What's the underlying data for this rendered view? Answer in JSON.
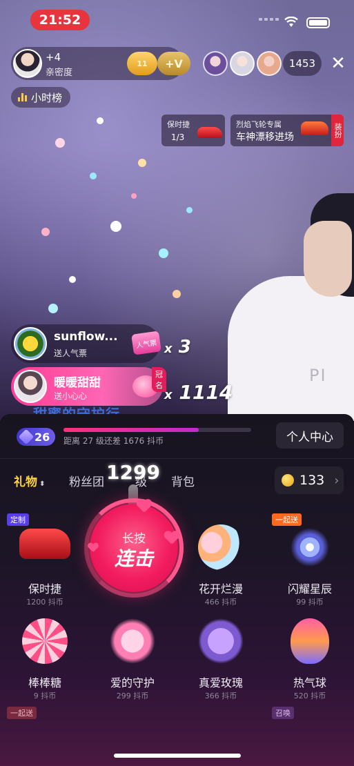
{
  "status_bar": {
    "time": "21:52"
  },
  "host": {
    "intimacy_plus": "+4",
    "intimacy_label": "亲密度",
    "fan_level": "11",
    "vip_badge": "+V"
  },
  "viewers": {
    "count": "1453"
  },
  "rank": {
    "label": "小时榜"
  },
  "promos": [
    {
      "title": "保时捷",
      "progress": "1/3"
    },
    {
      "title": "烈焰飞轮专属",
      "subtitle": "车神漂移进场",
      "tag": "装扮"
    }
  ],
  "gift_messages": [
    {
      "name": "sunflow...",
      "action": "送人气票",
      "gift_badge": "人气票",
      "combo_prefix": "x",
      "combo": "3"
    },
    {
      "name": "暖暖甜甜",
      "action": "送小心心",
      "crown": "冠名",
      "combo_prefix": "x",
      "combo": "1114"
    }
  ],
  "banner_text": "甜蜜的守护行",
  "panel": {
    "level": "26",
    "progress_fraction": 0.72,
    "progress_text": "距离 27 级还差 1676 抖币",
    "personal_center": "个人中心",
    "tabs": {
      "gift": "礼物",
      "gift_sort": "⬍",
      "fans": "粉丝团",
      "hidden": "级",
      "bag": "背包"
    },
    "coins": "133",
    "combo_count": "1299",
    "combo_button": {
      "line1": "长按",
      "line2": "连击"
    }
  },
  "gifts": [
    {
      "name": "保时捷",
      "price": "1200 抖币",
      "tag": "定制"
    },
    {
      "name": "花开烂漫",
      "price": "466 抖币"
    },
    {
      "name": "闪耀星辰",
      "price": "99 抖币",
      "tag": "一起送"
    },
    {
      "name": "棒棒糖",
      "price": "9 抖币"
    },
    {
      "name": "爱的守护",
      "price": "299 抖币"
    },
    {
      "name": "真爱玫瑰",
      "price": "366 抖币"
    },
    {
      "name": "热气球",
      "price": "520 抖币"
    }
  ],
  "bottom_tags": [
    "一起送",
    "召唤"
  ],
  "colors": {
    "accent_pink": "#f21c5f",
    "gold": "#ffd43a",
    "panel_bg": "#17141f"
  },
  "icons": [
    "wifi-icon",
    "battery-icon",
    "close-icon",
    "bars-icon",
    "coin-icon",
    "chevron-right-icon",
    "gem-icon"
  ]
}
